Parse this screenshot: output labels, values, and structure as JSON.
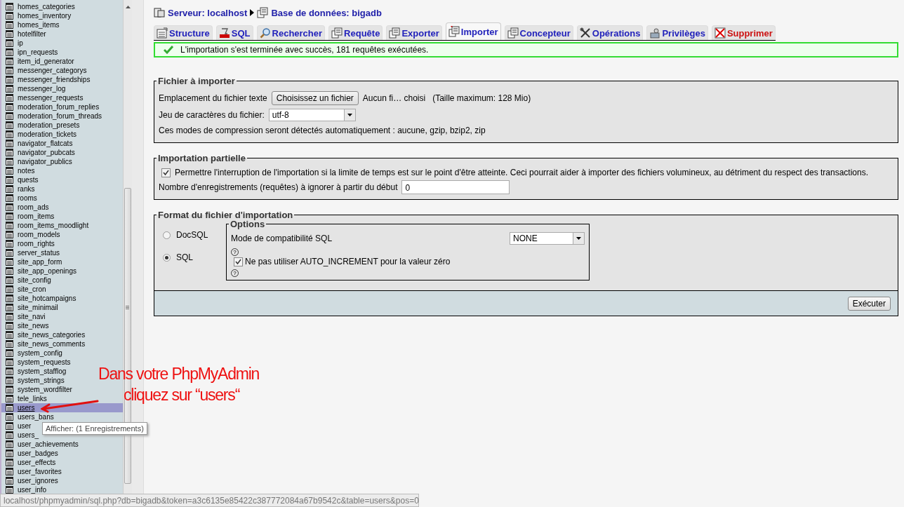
{
  "sidebar": {
    "tables": [
      {
        "name": "homes_categories",
        "selected": false
      },
      {
        "name": "homes_inventory",
        "selected": false
      },
      {
        "name": "homes_items",
        "selected": false
      },
      {
        "name": "hotelfilter",
        "selected": false
      },
      {
        "name": "ip",
        "selected": false
      },
      {
        "name": "ipn_requests",
        "selected": false
      },
      {
        "name": "item_id_generator",
        "selected": false
      },
      {
        "name": "messenger_categorys",
        "selected": false
      },
      {
        "name": "messenger_friendships",
        "selected": false
      },
      {
        "name": "messenger_log",
        "selected": false
      },
      {
        "name": "messenger_requests",
        "selected": false
      },
      {
        "name": "moderation_forum_replies",
        "selected": false
      },
      {
        "name": "moderation_forum_threads",
        "selected": false
      },
      {
        "name": "moderation_presets",
        "selected": false
      },
      {
        "name": "moderation_tickets",
        "selected": false
      },
      {
        "name": "navigator_flatcats",
        "selected": false
      },
      {
        "name": "navigator_pubcats",
        "selected": false
      },
      {
        "name": "navigator_publics",
        "selected": false
      },
      {
        "name": "notes",
        "selected": false
      },
      {
        "name": "quests",
        "selected": false
      },
      {
        "name": "ranks",
        "selected": false
      },
      {
        "name": "rooms",
        "selected": false
      },
      {
        "name": "room_ads",
        "selected": false
      },
      {
        "name": "room_items",
        "selected": false
      },
      {
        "name": "room_items_moodlight",
        "selected": false
      },
      {
        "name": "room_models",
        "selected": false
      },
      {
        "name": "room_rights",
        "selected": false
      },
      {
        "name": "server_status",
        "selected": false
      },
      {
        "name": "site_app_form",
        "selected": false
      },
      {
        "name": "site_app_openings",
        "selected": false
      },
      {
        "name": "site_config",
        "selected": false
      },
      {
        "name": "site_cron",
        "selected": false
      },
      {
        "name": "site_hotcampaigns",
        "selected": false
      },
      {
        "name": "site_minimail",
        "selected": false
      },
      {
        "name": "site_navi",
        "selected": false
      },
      {
        "name": "site_news",
        "selected": false
      },
      {
        "name": "site_news_categories",
        "selected": false
      },
      {
        "name": "site_news_comments",
        "selected": false
      },
      {
        "name": "system_config",
        "selected": false
      },
      {
        "name": "system_requests",
        "selected": false
      },
      {
        "name": "system_stafflog",
        "selected": false
      },
      {
        "name": "system_strings",
        "selected": false
      },
      {
        "name": "system_wordfilter",
        "selected": false
      },
      {
        "name": "tele_links",
        "selected": false
      },
      {
        "name": "users",
        "selected": true
      },
      {
        "name": "users_bans",
        "selected": false
      },
      {
        "name": "user",
        "selected": false
      },
      {
        "name": "users_",
        "selected": false
      },
      {
        "name": "user_achievements",
        "selected": false
      },
      {
        "name": "user_badges",
        "selected": false
      },
      {
        "name": "user_effects",
        "selected": false
      },
      {
        "name": "user_favorites",
        "selected": false
      },
      {
        "name": "user_ignores",
        "selected": false
      },
      {
        "name": "user_info",
        "selected": false
      }
    ],
    "tooltip": "Afficher:  (1 Enregistrements)"
  },
  "breadcrumb": {
    "server": "Serveur: localhost",
    "database": "Base de données: bigadb"
  },
  "tabs": [
    {
      "label": "Structure",
      "selected": false,
      "kind": "normal"
    },
    {
      "label": "SQL",
      "selected": false,
      "kind": "normal"
    },
    {
      "label": "Rechercher",
      "selected": false,
      "kind": "normal"
    },
    {
      "label": "Requête",
      "selected": false,
      "kind": "normal"
    },
    {
      "label": "Exporter",
      "selected": false,
      "kind": "normal"
    },
    {
      "label": "Importer",
      "selected": true,
      "kind": "normal"
    },
    {
      "label": "Concepteur",
      "selected": false,
      "kind": "normal"
    },
    {
      "label": "Opérations",
      "selected": false,
      "kind": "normal"
    },
    {
      "label": "Privilèges",
      "selected": false,
      "kind": "normal"
    },
    {
      "label": "Supprimer",
      "selected": false,
      "kind": "danger"
    }
  ],
  "success_message": "L'importation s'est terminée avec succès, 181 requêtes exécutées.",
  "file_section": {
    "legend": "Fichier à importer",
    "location_label": "Emplacement du fichier texte",
    "choose_button": "Choisissez un fichier",
    "file_status": "Aucun fi… choisi",
    "max_size": "(Taille maximum: 128 Mio)",
    "charset_label": "Jeu de caractères du fichier:",
    "charset": "utf-8",
    "compression_note": "Ces modes de compression seront détectés automatiquement : aucune, gzip, bzip2, zip"
  },
  "partial_section": {
    "legend": "Importation partielle",
    "allow_interrupt": {
      "label": "Permettre l'interruption de l'importation si la limite de temps est sur le point d'être atteinte. Ceci pourrait aider à importer des fichiers volumineux, au détriment du respect des transactions.",
      "checked": true
    },
    "skip_label": "Nombre d'enregistrements (requêtes) à ignorer à partir du début",
    "skip_value": "0"
  },
  "format_section": {
    "legend": "Format du fichier d'importation",
    "formats": [
      {
        "label": "DocSQL",
        "selected": false
      },
      {
        "label": "SQL",
        "selected": true
      }
    ],
    "options": {
      "legend": "Options",
      "compat_label": "Mode de compatibilité SQL",
      "compat_value": "NONE",
      "help_1": "?",
      "no_auto_increment": {
        "label": "Ne pas utiliser AUTO_INCREMENT pour la valeur zéro",
        "checked": true
      },
      "help_2": "?"
    }
  },
  "execute_button": "Exécuter",
  "annotation": {
    "line_1": "Dans votre PhpMyAdmin",
    "line_2": "cliquez sur “users“"
  },
  "status_bar": "localhost/phpmyadmin/sql.php?db=bigadb&token=a3c6135e85422c387772084a67b9542c&table=users&pos=0"
}
